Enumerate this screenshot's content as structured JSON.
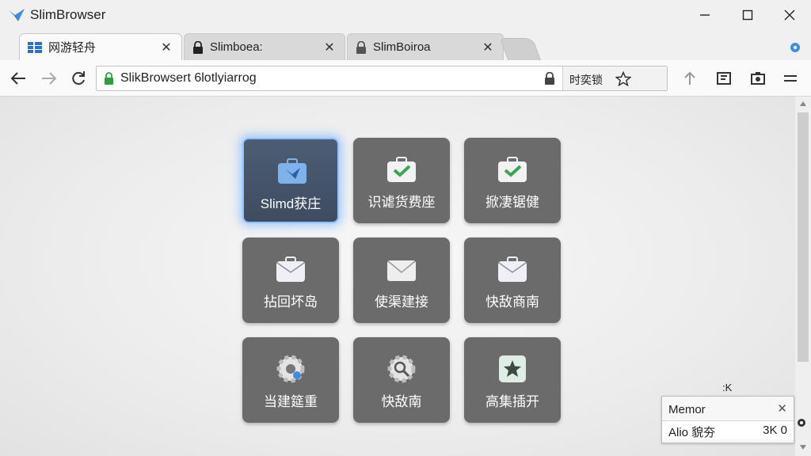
{
  "window": {
    "title": "SlimBrowser"
  },
  "tabs": [
    {
      "label": "网游轻舟",
      "close": "✕",
      "icon": "grid-icon"
    },
    {
      "label": "Slimboea:",
      "close": "✕",
      "icon": "lock-icon"
    },
    {
      "label": "SlimBoiroa",
      "close": "✕",
      "icon": "lock-icon"
    }
  ],
  "address_bar": {
    "url": "SlikBrowsert 6lotlyiarrog",
    "right_label": "时奕锁"
  },
  "tiles": [
    {
      "label": "Slimd获庄",
      "icon": "bird-briefcase-icon",
      "active": true
    },
    {
      "label": "识谑货费座",
      "icon": "check-briefcase-icon"
    },
    {
      "label": "掀凄锯健",
      "icon": "check-briefcase-icon"
    },
    {
      "label": "拈回坏岛",
      "icon": "mail-briefcase-icon"
    },
    {
      "label": "使渠建接",
      "icon": "mail-icon"
    },
    {
      "label": "快敌商南",
      "icon": "mail-briefcase-icon"
    },
    {
      "label": "当建筵重",
      "icon": "gear-icon"
    },
    {
      "label": "快敌南",
      "icon": "gear-search-icon"
    },
    {
      "label": "高集插开",
      "icon": "star-icon"
    }
  ],
  "popup": {
    "title": "Memor",
    "close": "✕",
    "row_label": "Alio 貌夯",
    "row_value": "3K 0"
  },
  "corner_mark": ":K",
  "colors": {
    "active_glow": "#8fc2ff",
    "tile_bg": "#6b6b6b",
    "check_green": "#3aa655",
    "lock_green": "#2e9e3e"
  }
}
